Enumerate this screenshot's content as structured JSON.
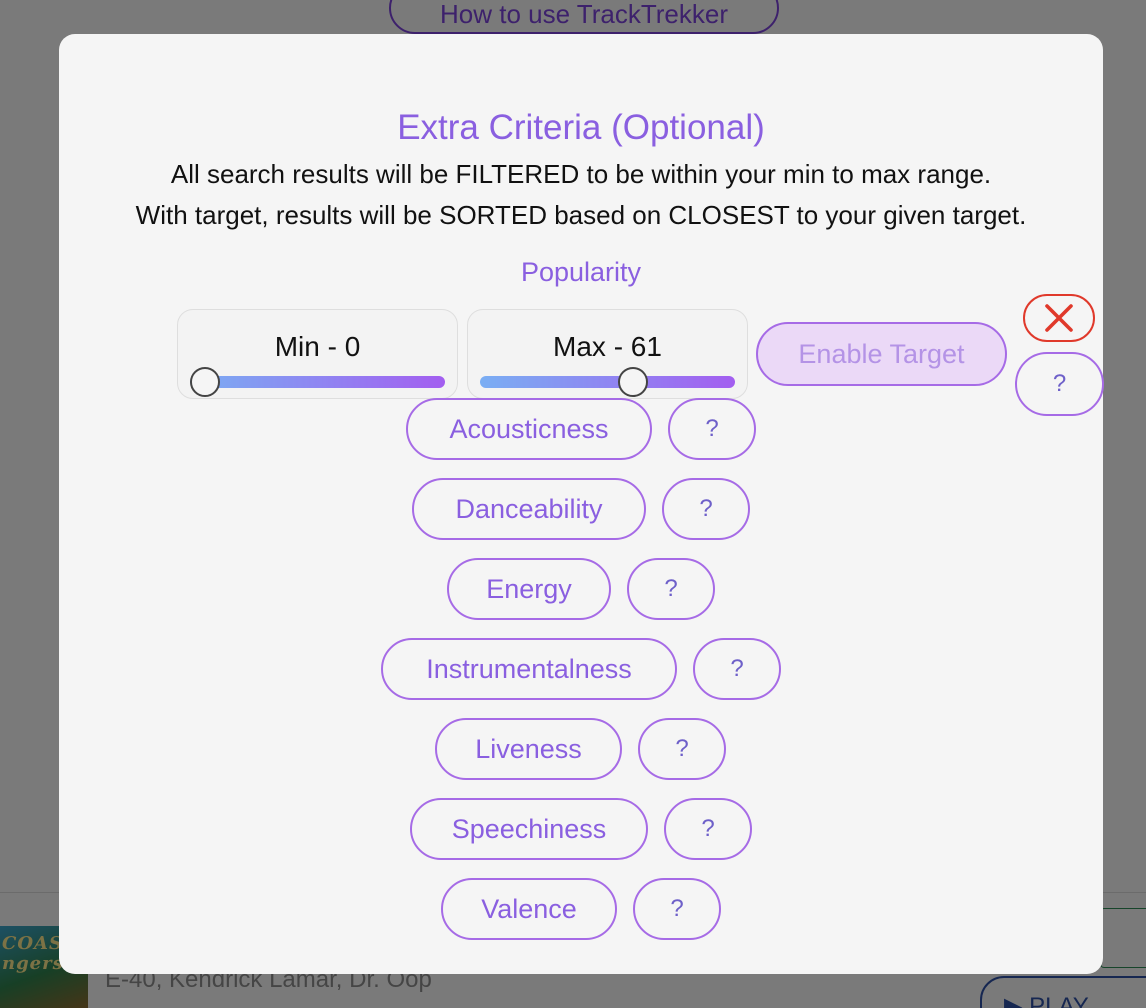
{
  "background": {
    "howto_label": "How to use TrackTrekker",
    "album_art_text": "COAST\nngers",
    "track_artists": "E-40, Kendrick Lamar, Dr. Oop",
    "play_label": "▶ PLAY"
  },
  "modal": {
    "title": "Extra Criteria (Optional)",
    "description_line1": "All search results will be FILTERED to be within your min to max range.",
    "description_line2": "With target, results will be SORTED based on CLOSEST to your given target.",
    "active_criterion": {
      "label": "Popularity",
      "min_label": "Min - 0",
      "max_label": "Max - 61",
      "min_value": 0,
      "max_value": 61,
      "range": [
        0,
        100
      ],
      "enable_target_label": "Enable Target",
      "help_label": "?",
      "remove_icon": "close-x-icon"
    },
    "criteria": [
      {
        "label": "Acousticness",
        "help_label": "?"
      },
      {
        "label": "Danceability",
        "help_label": "?"
      },
      {
        "label": "Energy",
        "help_label": "?"
      },
      {
        "label": "Instrumentalness",
        "help_label": "?"
      },
      {
        "label": "Liveness",
        "help_label": "?"
      },
      {
        "label": "Speechiness",
        "help_label": "?"
      },
      {
        "label": "Valence",
        "help_label": "?"
      }
    ]
  },
  "colors": {
    "accent": "#8a5fe0",
    "remove": "#e0392b",
    "slider_start": "#7aaef3",
    "slider_end": "#a35ef0"
  }
}
